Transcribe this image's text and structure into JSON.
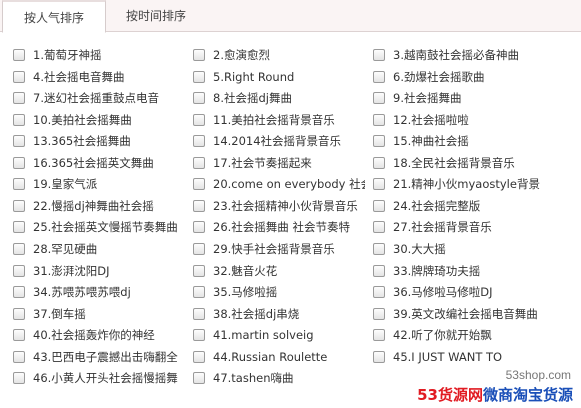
{
  "tabs": [
    {
      "label": "按人气排序",
      "active": true
    },
    {
      "label": "按时间排序",
      "active": false
    }
  ],
  "items": [
    "1.葡萄牙神摇",
    "2.愈演愈烈",
    "3.越南鼓社会摇必备神曲",
    "4.社会摇电音舞曲",
    "5.Right Round",
    "6.劲爆社会摇歌曲",
    "7.迷幻社会摇重鼓点电音",
    "8.社会摇dj舞曲",
    "9.社会摇舞曲",
    "10.美拍社会摇舞曲",
    "11.美拍社会摇背景音乐",
    "12.社会摇啦啦",
    "13.365社会摇舞曲",
    "14.2014社会摇背景音乐",
    "15.神曲社会摇",
    "16.365社会摇英文舞曲",
    "17.社会节奏摇起来",
    "18.全民社会摇背景音乐",
    "19.皇家气派",
    "20.come on everybody 社会",
    "21.精神小伙myaostyle背景",
    "22.慢摇dj神舞曲社会摇",
    "23.社会摇精神小伙背景音乐",
    "24.社会摇完整版",
    "25.社会摇英文慢摇节奏舞曲",
    "26.社会摇舞曲 社会节奏特",
    "27.社会摇背景音乐",
    "28.罕见硬曲",
    "29.快手社会摇背景音乐",
    "30.大大摇",
    "31.澎湃沈阳DJ",
    "32.魅音火花",
    "33.牌牌琦功夫摇",
    "34.苏喂苏喂苏喂dj",
    "35.马修啦摇",
    "36.马修啦马修啦DJ",
    "37.倒车摇",
    "38.社会摇dj串烧",
    "39.英文改编社会摇电音舞曲",
    "40.社会摇轰炸你的神经",
    "41.martin solveig",
    "42.听了你就开始飘",
    "43.巴西电子震撼出击嗨翻全",
    "44.Russian Roulette",
    "45.I JUST WANT TO",
    "46.小黄人开头社会摇慢摇舞",
    "47.tashen嗨曲"
  ],
  "watermark": {
    "url": "53shop.com",
    "brand_a": "53货源网",
    "brand_b": "微商淘宝货源"
  }
}
